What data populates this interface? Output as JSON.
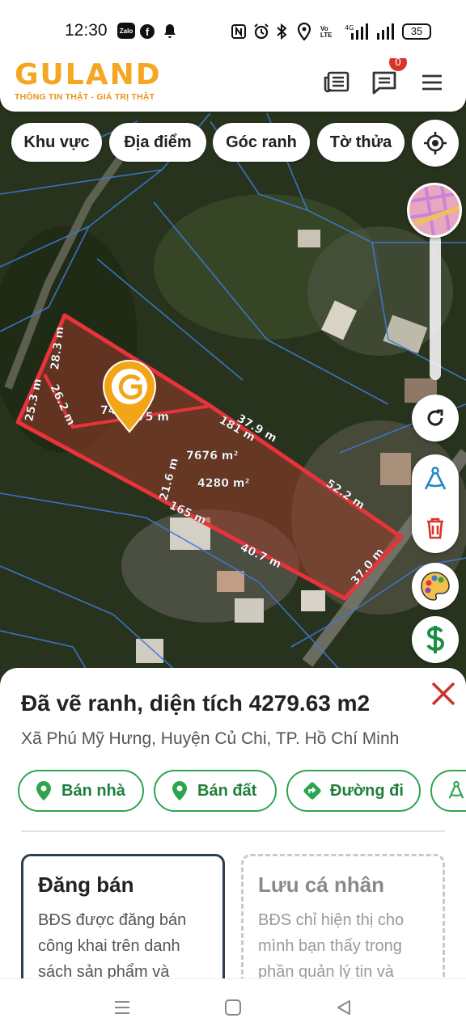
{
  "status_bar": {
    "time": "12:30",
    "volte": "Vo LTE",
    "battery": "35",
    "icons": [
      "zalo-icon",
      "facebook-icon",
      "bell-icon",
      "nfc-icon",
      "alarm-icon",
      "bluetooth-icon",
      "location-icon",
      "signal-icon",
      "signal-icon",
      "battery-icon"
    ]
  },
  "header": {
    "logo_text": "GULAND",
    "tagline": "THÔNG TIN THẬT - GIÁ TRỊ THẬT",
    "message_badge": "0",
    "icons": [
      "newspaper-icon",
      "chat-icon",
      "menu-icon"
    ]
  },
  "filters": {
    "khu_vuc": "Khu vực",
    "dia_diem": "Địa điểm",
    "goc_ranh": "Góc ranh",
    "to_thua": "Tờ thửa"
  },
  "map": {
    "labels": {
      "l1": "28.3 m",
      "l2": "25.3 m",
      "l3": "26.2 m",
      "l4": "74.9 m",
      "l4b": "75 m",
      "l5": "181 m",
      "l6": "37.9 m",
      "l7": "7676 m²",
      "l8": "4280 m²",
      "l9": "21.6 m",
      "l10": "165 m",
      "l11": "52.2 m",
      "l12": "40.7 m",
      "l13": "37.0 m"
    },
    "colors": {
      "boundary": "#e8333a",
      "parcel_line": "#3d7ad6",
      "marker": "#f2a516"
    }
  },
  "right_tools": [
    "locate-icon",
    "map-layer-thumbnail",
    "refresh-icon",
    "measure-icon",
    "trash-icon",
    "palette-icon",
    "dollar-icon"
  ],
  "sheet": {
    "title": "Đã vẽ ranh, diện tích 4279.63 m2",
    "subtitle": "Xã Phú Mỹ Hưng, Huyện Củ Chi, TP. Hồ Chí Minh",
    "actions": {
      "ban_nha": "Bán nhà",
      "ban_dat": "Bán đất",
      "duong_di": "Đường đi"
    },
    "cards": {
      "dang_ban_title": "Đăng bán",
      "dang_ban_desc": "BĐS được đăng bán công khai trên danh sách sản phẩm và",
      "luu_title": "Lưu cá nhân",
      "luu_desc": "BĐS chỉ hiện thị cho mình bạn thấy trong phần quản lý tin và"
    },
    "accent": "#2fa44f"
  }
}
